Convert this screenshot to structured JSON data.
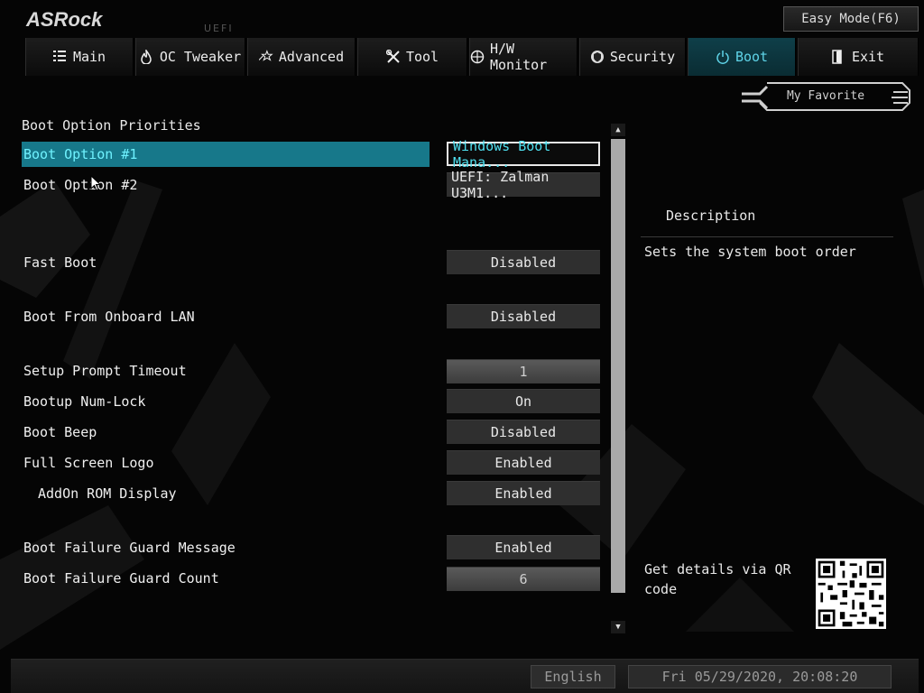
{
  "header": {
    "logo_text": "ASRock",
    "uefi_label": "UEFI",
    "easy_mode_label": "Easy Mode(F6)"
  },
  "tabs": [
    {
      "label": "Main",
      "icon": "list-icon"
    },
    {
      "label": "OC Tweaker",
      "icon": "flame-icon"
    },
    {
      "label": "Advanced",
      "icon": "star-icon"
    },
    {
      "label": "Tool",
      "icon": "tools-icon"
    },
    {
      "label": "H/W Monitor",
      "icon": "monitor-icon"
    },
    {
      "label": "Security",
      "icon": "shield-icon"
    },
    {
      "label": "Boot",
      "icon": "power-icon",
      "active": true
    },
    {
      "label": "Exit",
      "icon": "exit-icon"
    }
  ],
  "favorite_label": "My Favorite",
  "section_title": "Boot Option Priorities",
  "settings": [
    {
      "label": "Boot Option #1",
      "value": "Windows Boot Mana...",
      "selected": true
    },
    {
      "label": "Boot Option #2",
      "value": "UEFI: Zalman U3M1..."
    },
    {
      "label": "Fast Boot",
      "value": "Disabled"
    },
    {
      "label": "Boot From Onboard LAN",
      "value": "Disabled"
    },
    {
      "label": "Setup Prompt Timeout",
      "value": "1",
      "numeric": true
    },
    {
      "label": "Bootup Num-Lock",
      "value": "On"
    },
    {
      "label": "Boot Beep",
      "value": "Disabled"
    },
    {
      "label": "Full Screen Logo",
      "value": "Enabled"
    },
    {
      "label": "AddOn ROM Display",
      "value": "Enabled",
      "indent": true
    },
    {
      "label": "Boot Failure Guard Message",
      "value": "Enabled"
    },
    {
      "label": "Boot Failure Guard Count",
      "value": "6",
      "numeric": true
    }
  ],
  "description": {
    "title": "Description",
    "text": "Sets the system boot order",
    "qr_text": "Get details via QR code"
  },
  "footer": {
    "language": "English",
    "datetime": "Fri 05/29/2020, 20:08:20"
  },
  "colors": {
    "accent": "#17788a",
    "accent_text": "#6ff2ff"
  }
}
